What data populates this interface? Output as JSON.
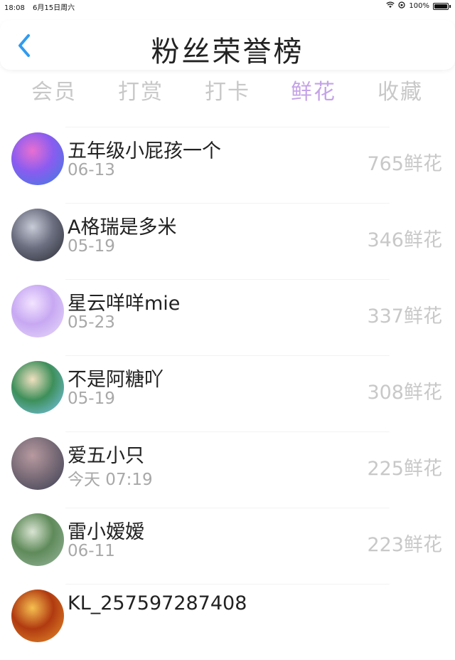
{
  "status_bar": {
    "time": "18:08",
    "date": "6月15日周六",
    "battery": "100%"
  },
  "header": {
    "title": "粉丝荣誉榜",
    "back_icon": "chevron-left-icon",
    "accent_color": "#2f9bef"
  },
  "tabs": [
    {
      "label": "会员",
      "active": false
    },
    {
      "label": "打赏",
      "active": false
    },
    {
      "label": "打卡",
      "active": false
    },
    {
      "label": "鲜花",
      "active": true
    },
    {
      "label": "收藏",
      "active": false
    }
  ],
  "active_tab_color": "#c4a3e8",
  "ranking": [
    {
      "name": "五年级小屁孩一个",
      "date": "06-13",
      "score": "765鲜花",
      "avatar_colors": [
        "#3a7fe0",
        "#8a5cf0",
        "#e86fd1"
      ]
    },
    {
      "name": "A格瑞是多米",
      "date": "05-19",
      "score": "346鲜花",
      "avatar_colors": [
        "#2b2b33",
        "#6b6f80",
        "#c8ccd8"
      ]
    },
    {
      "name": "星云咩咩mie",
      "date": "05-23",
      "score": "337鲜花",
      "avatar_colors": [
        "#e9defa",
        "#c7a8f2",
        "#f3e4ff"
      ]
    },
    {
      "name": "不是阿糖吖",
      "date": "05-19",
      "score": "308鲜花",
      "avatar_colors": [
        "#7cc6f0",
        "#3d8f5a",
        "#f0e0c0"
      ]
    },
    {
      "name": "爱五小只",
      "date": "今天 07:19",
      "score": "225鲜花",
      "avatar_colors": [
        "#3b3f55",
        "#7e6f7a",
        "#b89aa0"
      ]
    },
    {
      "name": "雷小嫒嫒",
      "date": "06-11",
      "score": "223鲜花",
      "avatar_colors": [
        "#9ab7a0",
        "#5f8a5a",
        "#d9e4d2"
      ]
    },
    {
      "name": "KL_257597287408",
      "date": "",
      "score": "",
      "avatar_colors": [
        "#e8902a",
        "#b03a10",
        "#f6c050"
      ]
    }
  ]
}
